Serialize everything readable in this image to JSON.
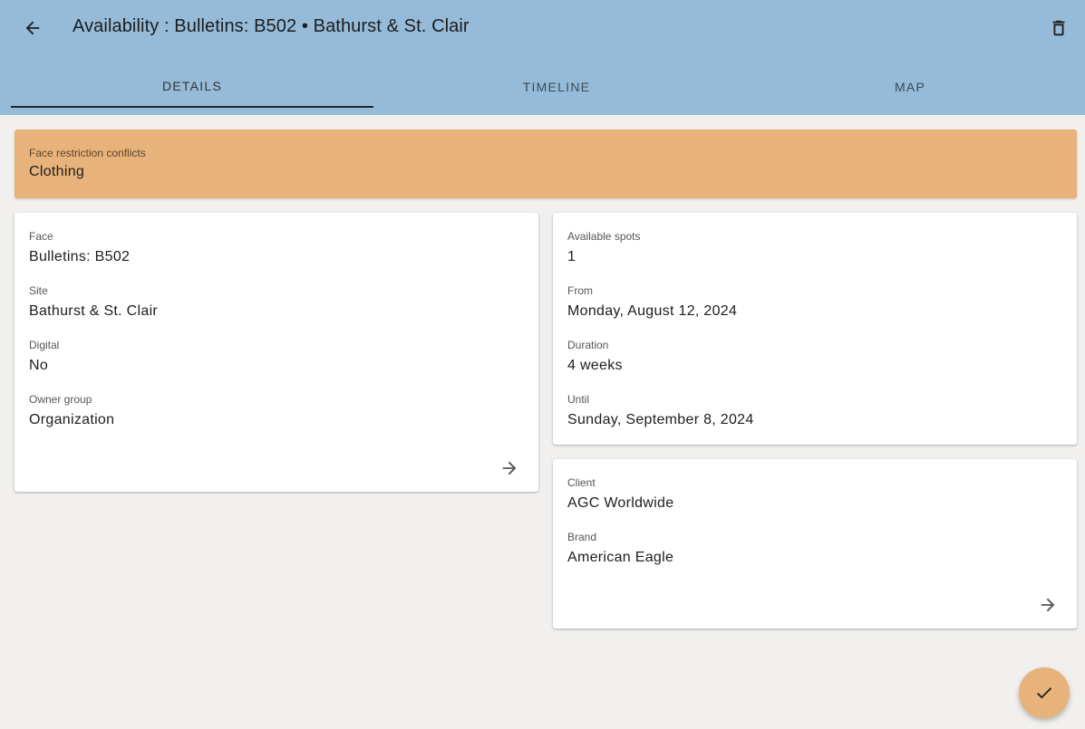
{
  "app_bar": {
    "title": "Availability : Bulletins: B502 • Bathurst & St. Clair",
    "back_icon": "arrow-left-icon",
    "delete_icon": "trash-icon"
  },
  "tabs": [
    {
      "label": "DETAILS",
      "active": true
    },
    {
      "label": "TIMELINE",
      "active": false
    },
    {
      "label": "MAP",
      "active": false
    }
  ],
  "conflict_banner": {
    "label": "Face restriction conflicts",
    "value": "Clothing"
  },
  "face_card": {
    "fields": [
      {
        "label": "Face",
        "value": "Bulletins: B502"
      },
      {
        "label": "Site",
        "value": "Bathurst & St. Clair"
      },
      {
        "label": "Digital",
        "value": "No"
      },
      {
        "label": "Owner group",
        "value": "Organization"
      }
    ]
  },
  "availability_card": {
    "fields": [
      {
        "label": "Available spots",
        "value": "1"
      },
      {
        "label": "From",
        "value": "Monday, August 12, 2024"
      },
      {
        "label": "Duration",
        "value": "4 weeks"
      },
      {
        "label": "Until",
        "value": "Sunday, September 8, 2024"
      }
    ]
  },
  "client_card": {
    "fields": [
      {
        "label": "Client",
        "value": "AGC Worldwide"
      },
      {
        "label": "Brand",
        "value": "American Eagle"
      }
    ]
  },
  "colors": {
    "app_bar": "#95bbd9",
    "accent": "#e8b37a",
    "background": "#f1f0ee"
  },
  "fab_icon": "check-icon"
}
